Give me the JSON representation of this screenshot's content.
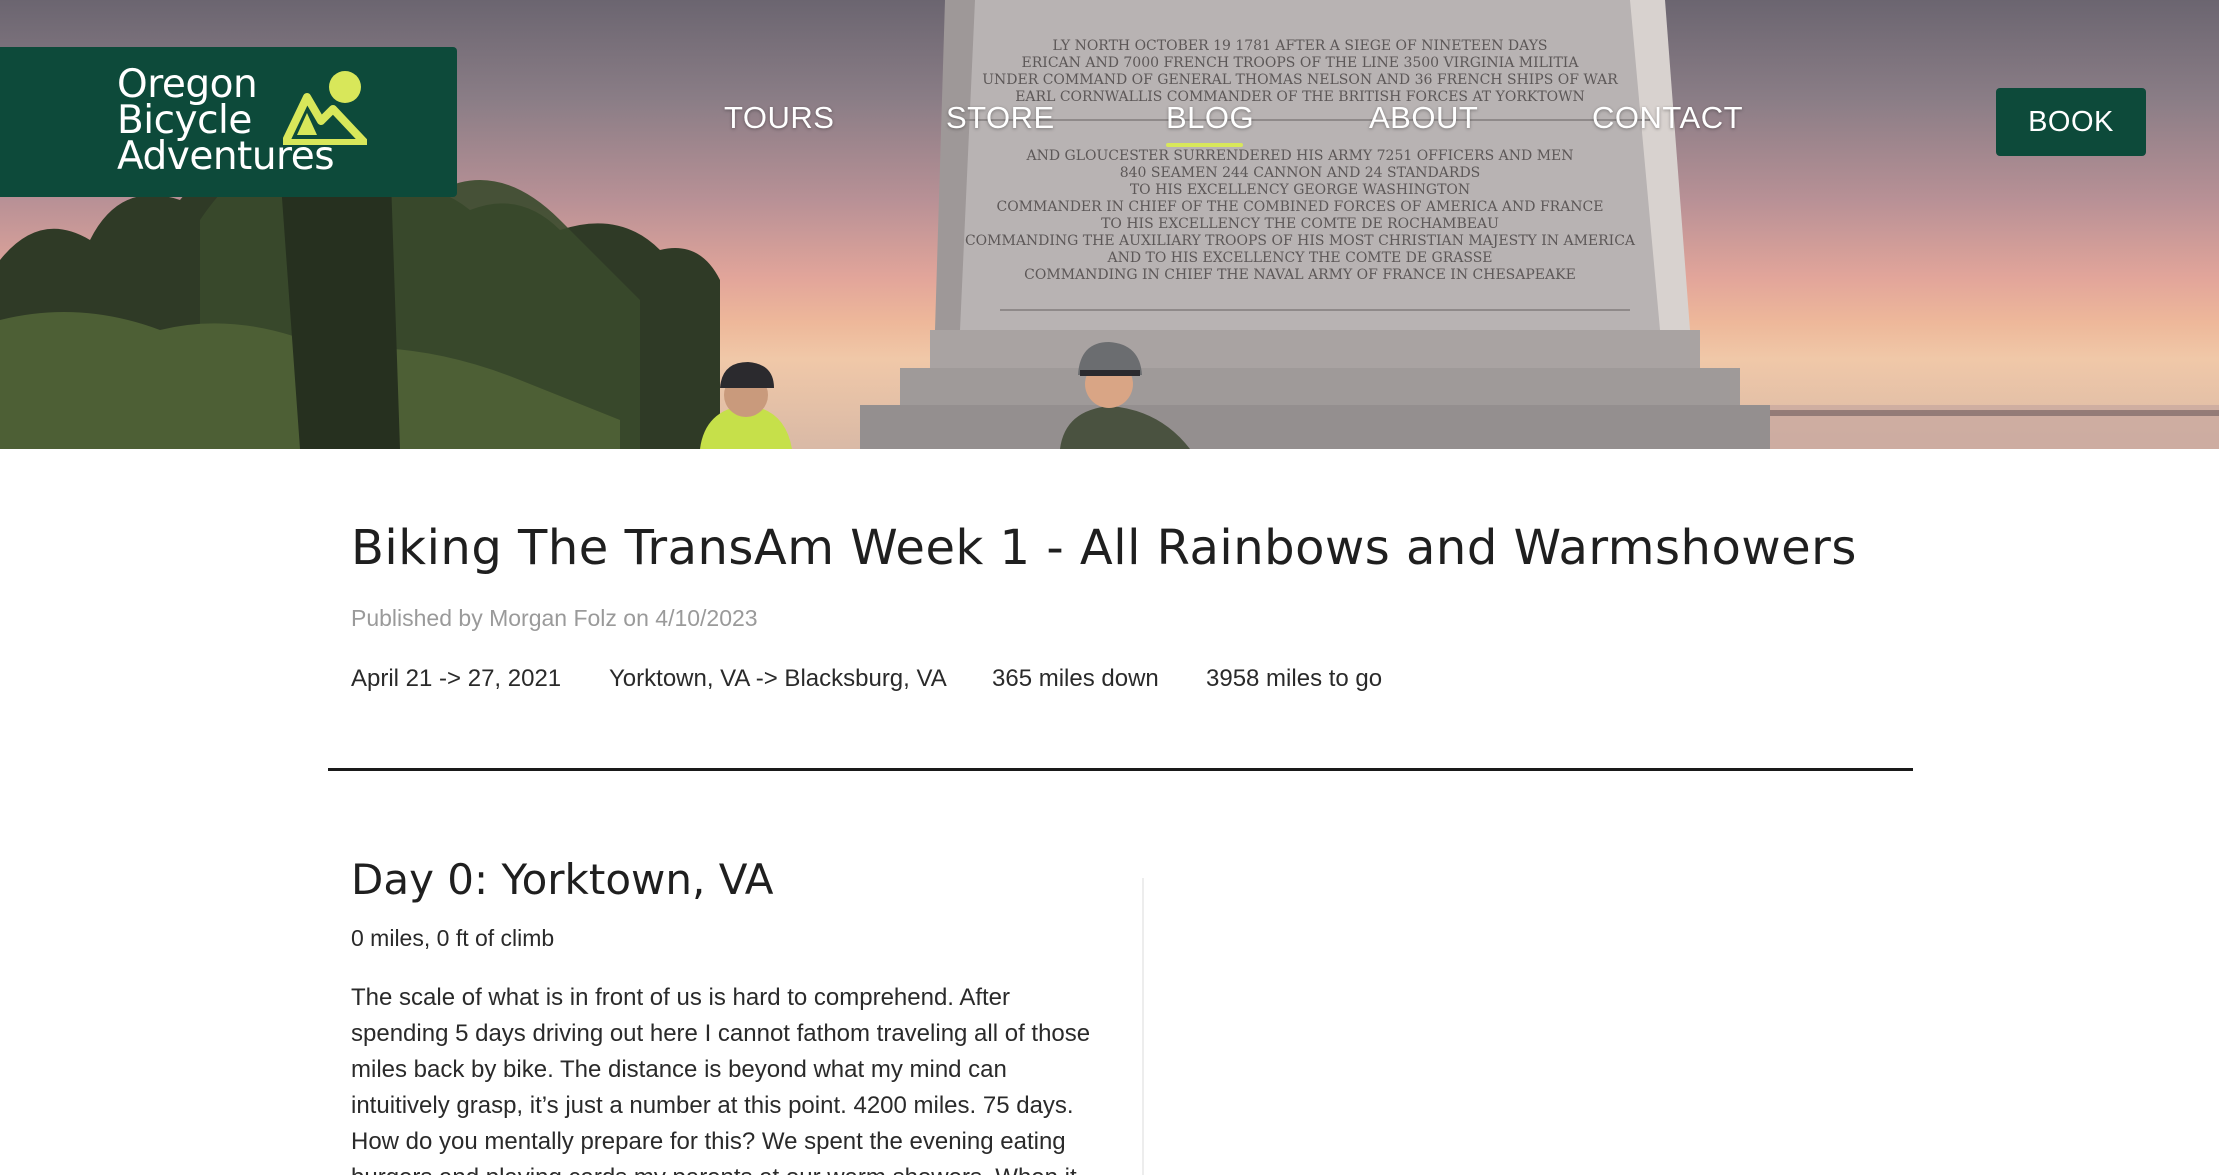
{
  "brand": {
    "line1": "Oregon",
    "line2": "Bicycle",
    "line3": "Adventures",
    "accent_color": "#d8e75a",
    "bg_color": "#0d4a3a"
  },
  "nav": {
    "tours": "TOURS",
    "store": "STORE",
    "blog": "BLOG",
    "about": "ABOUT",
    "contact": "CONTACT",
    "active": "BLOG"
  },
  "book_label": "BOOK",
  "hero_inscription": [
    "LY NORTH OCTOBER 19 1781 AFTER A SIEGE OF NINETEEN DAYS",
    "ERICAN AND 7000 FRENCH TROOPS OF THE LINE 3500 VIRGINIA MILITIA",
    "UNDER COMMAND OF GENERAL THOMAS NELSON AND 36 FRENCH SHIPS OF WAR",
    "EARL CORNWALLIS COMMANDER OF THE BRITISH FORCES AT YORKTOWN",
    "AND GLOUCESTER SURRENDERED HIS ARMY 7251 OFFICERS AND MEN",
    "840 SEAMEN 244 CANNON AND 24 STANDARDS",
    "TO HIS EXCELLENCY GEORGE WASHINGTON",
    "COMMANDER IN CHIEF OF THE COMBINED FORCES OF AMERICA AND FRANCE",
    "TO HIS EXCELLENCY THE COMTE DE ROCHAMBEAU",
    "COMMANDING THE AUXILIARY TROOPS OF HIS MOST CHRISTIAN MAJESTY IN AMERICA",
    "AND TO HIS EXCELLENCY THE COMTE DE GRASSE",
    "COMMANDING IN CHIEF THE NAVAL ARMY OF FRANCE IN CHESAPEAKE"
  ],
  "post": {
    "title": "Biking The TransAm Week 1 - All Rainbows and Warmshowers",
    "byline": "Published by Morgan Folz on 4/10/2023",
    "dates": "April 21 -> 27, 2021",
    "route": "Yorktown, VA -> Blacksburg, VA",
    "miles_down": "365 miles down",
    "miles_to_go": "3958 miles to go"
  },
  "day0": {
    "title": "Day 0: Yorktown, VA",
    "stats": "0 miles, 0 ft of climb",
    "lines": [
      "The scale of what is in front of us is hard to comprehend. After",
      "spending 5 days driving out here I cannot fathom traveling all of those",
      "miles back by bike. The distance is beyond what my mind can",
      "intuitively grasp, it’s just a number at this point. 4200 miles. 75 days.",
      "How do you mentally prepare for this? We spent the evening eating",
      "burgers and playing cards my parents at our warm showers. When it"
    ]
  }
}
